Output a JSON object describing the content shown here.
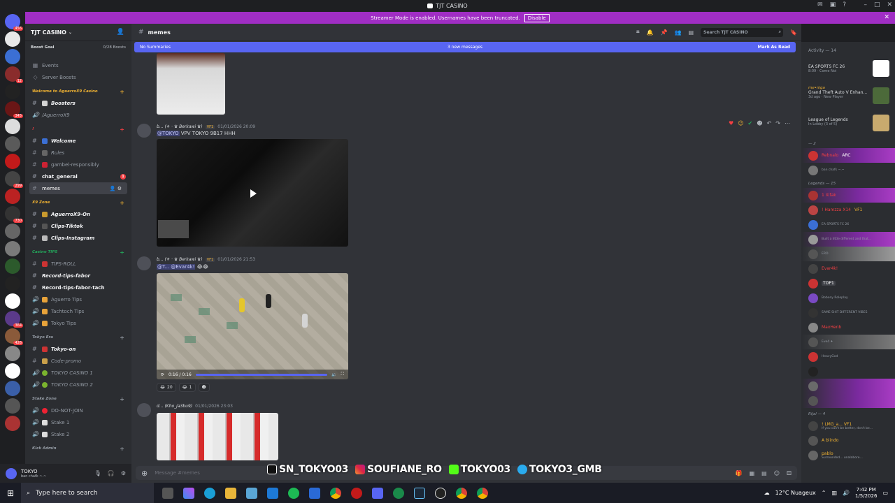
{
  "window": {
    "title": "TJT CASINO"
  },
  "banner": {
    "text": "Streamer Mode is enabled. Usernames have been truncated.",
    "disable_label": "Disable"
  },
  "server": {
    "name": "TJT CASINO",
    "boost_goal": "Boost Goal",
    "boost_count": "0/28 Boosts"
  },
  "sidebar_top": [
    {
      "label": "Events",
      "icon": "calendar-icon"
    },
    {
      "label": "Server Boosts",
      "icon": "boost-icon"
    }
  ],
  "categories": {
    "cat1": "Welcome to AguerroX9 Casino",
    "cat2": "!",
    "cat3": "X9 Zone",
    "cat4": "Casino TIPS",
    "cat5": "Tokyo Era",
    "cat6": "Stake Zone",
    "cat7": "Kick Admin"
  },
  "channels": {
    "boosters": "Boosters",
    "aguerrox9": "/AguerroX9",
    "welcome": "Welcome",
    "rules": "Rules",
    "gambel": "gambel-responsibly",
    "chat_general": "chat_general",
    "chat_general_unread": "1",
    "memes": "memes",
    "aguerrox9_on": "AguerroX9-On",
    "clips_tiktok": "Clips-Tiktok",
    "clips_instagram": "Clips-Instagram",
    "tips_roll": "TIPS-ROLL",
    "record_tips_fabor": "Record-tips-fabor",
    "record_tips_fabor_tach": "Record-tips-fabor-tach",
    "aguerro_tips": "Aguerro Tips",
    "tachtoch_tips": "Tachtoch Tips",
    "tokyo_tips": "Tokyo Tips",
    "tokyo_on": "Tokyo-on",
    "code_promo": "Code-promo",
    "tokyo_casino_1": "TOKYO CASINO 1",
    "tokyo_casino_2": "TOKYO CASINO 2",
    "do_not_join": "DO-NOT-JOIN",
    "stake_1": "Stake 1",
    "stake_2": "Stake 2"
  },
  "user": {
    "name": "TOKYO",
    "status": "ban chafk ~.~"
  },
  "channel_header": {
    "name": "memes",
    "search_placeholder": "Search TJT CASINO"
  },
  "new_bar": {
    "left": "No Summaries",
    "middle": "3 new messages",
    "right": "Mark As Read"
  },
  "messages": [
    {
      "author": "b... (⚜ · ♛ Berkawi ♛)",
      "tag": "VF1",
      "time": "01/01/2026 20:09",
      "mention": "@TOKYO",
      "text": "VPV TOKYO 9B17 HHH"
    },
    {
      "author": "b... (⚜ · ♛ Berkawi ♛)",
      "tag": "VF1",
      "time": "01/01/2026 21:53",
      "mention": "@T... @Evar4k!",
      "text": "😂😂",
      "video_time": "0:16 / 0:16",
      "video_progress": 1.0,
      "reactions": [
        {
          "emoji": "😂",
          "count": "20"
        },
        {
          "emoji": "😂",
          "count": "1"
        }
      ]
    },
    {
      "author": "d... (Kho_ja3bu9)",
      "time": "01/01/2026 23:03"
    }
  ],
  "composer": {
    "placeholder": "Message #memes"
  },
  "socials": [
    {
      "platform": "tiktok",
      "handle": "SN_TOKYO03"
    },
    {
      "platform": "instagram",
      "handle": "SOUFIANE_RO"
    },
    {
      "platform": "kick",
      "handle": "TOKYO03"
    },
    {
      "platform": "telegram",
      "handle": "TOKYO3_GMB"
    }
  ],
  "activity": {
    "header": "Activity — 14",
    "items": [
      {
        "title": "EA SPORTS FC 26",
        "user": "",
        "sub": "8:09 · Come Noi"
      },
      {
        "title": "Grand Theft Auto V Enhan...",
        "user": "me•niga",
        "sub": "3d ago · New Player"
      },
      {
        "title": "League of Legends",
        "user": "",
        "sub": "In Lobby (3 of 5)"
      }
    ]
  },
  "member_groups": {
    "g1": "— 2",
    "g2": "Legends — 15",
    "g3": "Rijal — 4"
  },
  "members": [
    {
      "name": "Rebnalo",
      "sub": "",
      "tag": "ARC"
    },
    {
      "name": "",
      "sub": "ban chafk ~.~",
      "tag": ""
    },
    {
      "name": "1 Xifak",
      "sub": "",
      "tag": ""
    },
    {
      "name": "! Hamzza X14",
      "sub": "",
      "tag": "VF1"
    },
    {
      "name": "",
      "sub": "EA SPORTS FC 26",
      "tag": ""
    },
    {
      "name": "",
      "sub": "Built a little different and that...",
      "tag": ""
    },
    {
      "name": "",
      "sub": "ERO",
      "tag": ""
    },
    {
      "name": "Evar4k!",
      "sub": "",
      "tag": ""
    },
    {
      "name": "",
      "sub": "",
      "tag": "TOP1"
    },
    {
      "name": "",
      "sub": "Bobony Roleplay",
      "tag": ""
    },
    {
      "name": "",
      "sub": "SAME SHIT DIFFERENT VIBES",
      "tag": ""
    },
    {
      "name": "MaxHenb",
      "sub": "",
      "tag": ""
    },
    {
      "name": "",
      "sub": "Eve4 ✦",
      "tag": "gold"
    },
    {
      "name": "",
      "sub": "HeavyGod",
      "tag": ""
    },
    {
      "name": "! LMG_a...",
      "sub": "If you can't be better, don't be...",
      "tag": "VF1"
    },
    {
      "name": "A blindo",
      "sub": "",
      "tag": ""
    },
    {
      "name": "pablo",
      "sub": "Surrounded... unalabore...",
      "tag": ""
    }
  ],
  "taskbar": {
    "search_placeholder": "Type here to search",
    "weather": "12°C Nuageux",
    "time": "7:42 PM",
    "date": "1/5/2026"
  },
  "colors": {
    "blurple": "#5865f2",
    "streamer_banner": "#a02ec4",
    "mention": "#c9cdfb"
  }
}
